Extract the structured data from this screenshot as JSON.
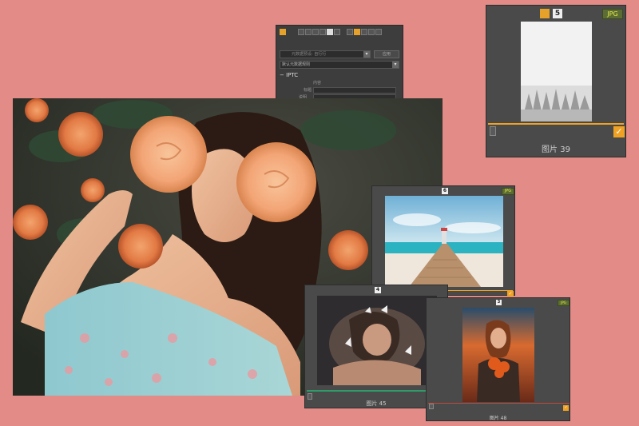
{
  "meta_panel": {
    "dropdown_1": "元数据预设: 自行行",
    "apply_button": "应用",
    "dropdown_2": "默认元数据规则",
    "section_title": "IPTC",
    "field_header": "内容",
    "field_1_label": "标题",
    "field_2_label": "说明"
  },
  "cards": {
    "card_39": {
      "number": "5",
      "format": "JPG",
      "label": "图片 39"
    },
    "card_pier": {
      "number": "6",
      "format": "JPG"
    },
    "card_45": {
      "number": "4",
      "label": "图片 45"
    },
    "card_48": {
      "number": "3",
      "format": "JPG",
      "label": "图片 48"
    }
  },
  "colors": {
    "background": "#e38b86",
    "accent_orange": "#f0a225",
    "panel": "#4a4a4a"
  }
}
